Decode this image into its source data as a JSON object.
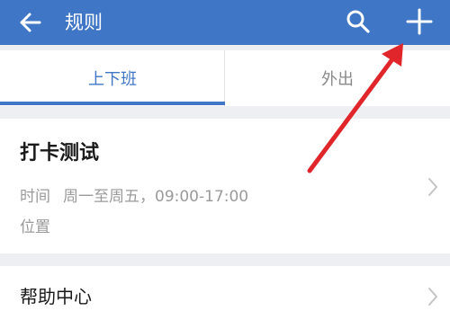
{
  "appbar": {
    "title": "规则",
    "back_icon": "back-arrow-icon",
    "search_icon": "search-icon",
    "add_icon": "plus-icon",
    "color": "#3f76c6"
  },
  "tabs": [
    {
      "label": "上下班",
      "active": true
    },
    {
      "label": "外出",
      "active": false
    }
  ],
  "rule": {
    "name": "打卡测试",
    "time_label": "时间",
    "time_value": "周一至周五，09:00-17:00",
    "location_label": "位置"
  },
  "help": {
    "label": "帮助中心"
  },
  "annotation": {
    "color": "#e0262b"
  }
}
